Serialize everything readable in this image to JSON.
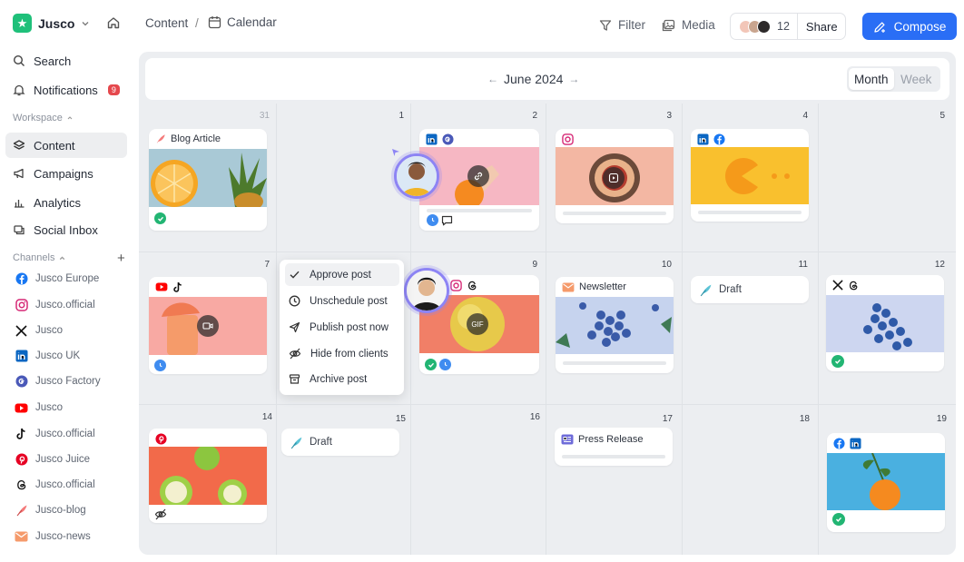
{
  "brand": {
    "name": "Jusco"
  },
  "sidebar": {
    "nav": [
      {
        "label": "Search",
        "icon": "search-icon"
      },
      {
        "label": "Notifications",
        "icon": "bell-icon",
        "badge": "9"
      }
    ],
    "workspace_label": "Workspace",
    "workspace_items": [
      {
        "label": "Content",
        "icon": "layers-icon",
        "active": true
      },
      {
        "label": "Campaigns",
        "icon": "megaphone-icon"
      },
      {
        "label": "Analytics",
        "icon": "bar-chart-icon"
      },
      {
        "label": "Social Inbox",
        "icon": "inbox-icon"
      }
    ],
    "channels_label": "Channels",
    "channels": [
      {
        "label": "Jusco Europe",
        "icon": "facebook-icon"
      },
      {
        "label": "Jusco.official",
        "icon": "instagram-icon"
      },
      {
        "label": "Jusco",
        "icon": "x-icon"
      },
      {
        "label": "Jusco UK",
        "icon": "linkedin-icon"
      },
      {
        "label": "Jusco Factory",
        "icon": "google-icon"
      },
      {
        "label": "Jusco",
        "icon": "youtube-icon"
      },
      {
        "label": "Jusco.official",
        "icon": "tiktok-icon"
      },
      {
        "label": "Jusco Juice",
        "icon": "pinterest-icon"
      },
      {
        "label": "Jusco.official",
        "icon": "threads-icon"
      },
      {
        "label": "Jusco-blog",
        "icon": "quill-icon"
      },
      {
        "label": "Jusco-news",
        "icon": "mail-icon"
      }
    ]
  },
  "breadcrumb": {
    "root": "Content",
    "separator": "/",
    "current": "Calendar"
  },
  "toolbar": {
    "filter": "Filter",
    "media": "Media",
    "share_count": "12",
    "share": "Share",
    "compose": "Compose"
  },
  "calendar": {
    "month_label": "June 2024",
    "prev_arrow": "←",
    "next_arrow": "→",
    "view_month": "Month",
    "view_week": "Week",
    "days": [
      "31",
      "1",
      "2",
      "3",
      "4",
      "5",
      "7",
      "9",
      "10",
      "11",
      "12",
      "14",
      "15",
      "16",
      "17",
      "18",
      "19"
    ],
    "cards": {
      "blog_article": "Blog Article",
      "newsletter": "Newsletter",
      "press_release": "Press Release",
      "draft": "Draft",
      "gif": "GIF"
    },
    "context_menu": [
      "Approve post",
      "Unschedule post",
      "Publish post now",
      "Hide from clients",
      "Archive post"
    ]
  },
  "colors": {
    "accent": "#2a6ef5",
    "success": "#22b573",
    "scheduled": "#3f8cf0",
    "badge": "#e5484d",
    "avatar_ring": "#8d84f4"
  }
}
